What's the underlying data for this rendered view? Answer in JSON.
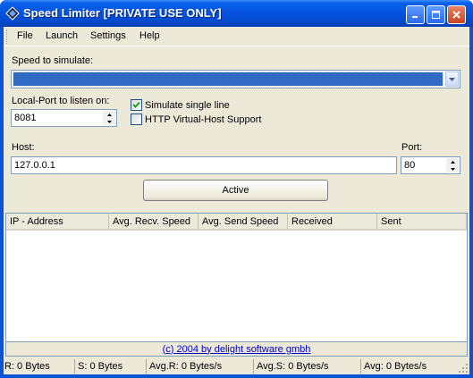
{
  "window": {
    "title": "Speed Limiter [PRIVATE USE ONLY]",
    "icon": "app-diamond-icon"
  },
  "menu": {
    "items": [
      "File",
      "Launch",
      "Settings",
      "Help"
    ]
  },
  "form": {
    "speed_label": "Speed to simulate:",
    "speed_value": "",
    "local_port_label": "Local-Port to listen on:",
    "local_port_value": "8081",
    "simulate_single_line_label": "Simulate single line",
    "simulate_single_line_checked": true,
    "http_vhost_label": "HTTP Virtual-Host Support",
    "http_vhost_checked": false,
    "host_label": "Host:",
    "host_value": "127.0.0.1",
    "port_label": "Port:",
    "port_value": "80",
    "active_button": "Active"
  },
  "list": {
    "columns": [
      "IP - Address",
      "Avg. Recv. Speed",
      "Avg. Send Speed",
      "Received",
      "Sent"
    ],
    "rows": []
  },
  "copyright": "(c) 2004 by delight software gmbh",
  "status": {
    "received": "R: 0 Bytes",
    "sent": "S: 0 Bytes",
    "avg_received": "Avg.R: 0 Bytes/s",
    "avg_sent": "Avg.S: 0 Bytes/s",
    "avg": "Avg: 0 Bytes/s"
  },
  "colors": {
    "titlebar": "#0553e0",
    "selection": "#316ac5",
    "link": "#0000c0"
  }
}
